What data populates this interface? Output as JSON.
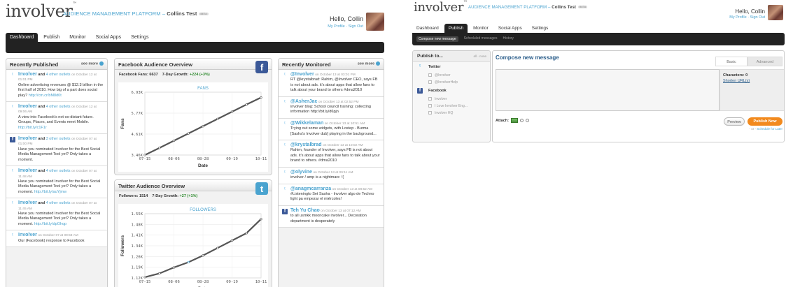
{
  "left": {
    "brand": {
      "logo": "involver",
      "tm": "™",
      "platform": "AUDIENCE MANAGEMENT PLATFORM",
      "dash": "–",
      "account": "Collins Test",
      "badge": "BETA"
    },
    "user": {
      "greeting": "Hello, Collin",
      "profile_link": "My Profile",
      "sep": "·",
      "signout_link": "Sign Out"
    },
    "nav": {
      "tabs": [
        "Dashboard",
        "Publish",
        "Monitor",
        "Social Apps",
        "Settings"
      ],
      "active": 0
    },
    "recently_published": {
      "title": "Recently Published",
      "see_more": "see more",
      "items": [
        {
          "author": "Involver",
          "and_text": "and",
          "others": "4 other outlets",
          "meta": "on October 12 at 01:01 PM",
          "body": "Online advertising revenues @ $12.3 billion in the first half of 2010. How big of a part does social play?",
          "link": "http://cm.cr/bM8d0t",
          "source": "twitter"
        },
        {
          "author": "Involver",
          "and_text": "and",
          "others": "4 other outlets",
          "meta": "on October 12 at 09:06 AM",
          "body": "A view into Facebook's not-so-distant future. Groups, Places, and Events meet Mobile.",
          "link": "http://bit.ly/c1F1r",
          "source": "twitter"
        },
        {
          "author": "Involver",
          "and_text": "and",
          "others": "3 other outlets",
          "meta": "on October 07 at 01:00 PM",
          "body": "Have you nominated Involver for the Best Social Media Management Tool yet? Only takes a moment.",
          "link": "",
          "source": "facebook"
        },
        {
          "author": "Involver",
          "and_text": "and",
          "others": "4 other outlets",
          "meta": "on October 07 at 11:48 AM",
          "body": "Have you nominated Involver for the Best Social Media Management Tool yet? Only takes a moment.",
          "link": "http://bit.ly/auYjmw",
          "source": "twitter"
        },
        {
          "author": "Involver",
          "and_text": "and",
          "others": "4 other outlets",
          "meta": "on October 07 at 11:45 AM",
          "body": "Have you nominated Involver for the Best Social Media Management Tool yet? Only takes a moment.",
          "link": "http://bit.ly/dpGhqp",
          "source": "twitter"
        },
        {
          "author": "Involver",
          "and_text": "",
          "others": "",
          "meta": "on October 07 at 09:58 AM",
          "body": "Our (Facebook) response to Facebook",
          "link": "",
          "source": "twitter"
        }
      ]
    },
    "facebook_overview": {
      "title": "Facebook Audience Overview",
      "stat_label": "Facebook Fans:",
      "stat_value": "6637",
      "growth_label": "7-Day Growth:",
      "growth_value": "+224 (+3%)",
      "icon": "facebook-icon",
      "icon_glyph": "f",
      "icon_color": "#3b5998",
      "chart_data": {
        "type": "line",
        "title": "FANS",
        "xlabel": "Date",
        "ylabel": "Fans",
        "x_ticks": [
          "07-15",
          "08-06",
          "08-28",
          "09-19",
          "10-11"
        ],
        "y_ticks": [
          "3.46K",
          "4.61K",
          "5.77K",
          "6.93K"
        ],
        "ylim": [
          3460,
          6930
        ],
        "x": [
          "07-15",
          "07-26",
          "08-06",
          "08-17",
          "08-28",
          "09-08",
          "09-19",
          "09-30",
          "10-11"
        ],
        "values": [
          3460,
          3850,
          4250,
          4650,
          5050,
          5450,
          5850,
          6250,
          6637
        ],
        "grid": true,
        "color": "#555555"
      }
    },
    "twitter_overview": {
      "title": "Twitter Audience Overview",
      "stat_label": "Followers:",
      "stat_value": "1514",
      "growth_label": "7-Day Growth:",
      "growth_value": "+27 (+1%)",
      "icon": "twitter-icon",
      "icon_glyph": "t",
      "icon_color": "#4aa3cf",
      "chart_data": {
        "type": "line",
        "title": "FOLLOWERS",
        "xlabel": "Date",
        "ylabel": "Followers",
        "x_ticks": [
          "07-15",
          "08-06",
          "08-28",
          "09-19",
          "10-11"
        ],
        "y_ticks": [
          "1.12K",
          "1.19K",
          "1.26K",
          "1.34K",
          "1.41K",
          "1.48K",
          "1.55K"
        ],
        "ylim": [
          1120,
          1550
        ],
        "x": [
          "07-15",
          "07-26",
          "08-06",
          "08-17",
          "08-28",
          "09-08",
          "09-19",
          "09-30",
          "10-11"
        ],
        "values": [
          1125,
          1150,
          1190,
          1225,
          1270,
          1320,
          1370,
          1420,
          1514
        ],
        "grid": true,
        "color": "#555555",
        "marker_color": "#4aa3cf"
      }
    },
    "recently_monitored": {
      "title": "Recently Monitored",
      "see_more": "see more",
      "items": [
        {
          "author": "@Involver",
          "meta": "on October 13 at 03:01 PM",
          "body": "RT @krystalbrad: Rahim, @Involver CEO, says FB is not about ads. it's about apps that allow fans to talk about your brand to others #dma2010",
          "source": "twitter"
        },
        {
          "author": "@AsherJac",
          "meta": "on October 13 at 02:52 PM",
          "body": "involver blog: School council training: collecting information http://bit.ly/d6pjn",
          "source": "twitter"
        },
        {
          "author": "@Wikkelaman",
          "meta": "on October 13 at 10:51 AM",
          "body": "Trying out some widgets, with Lostep - Burma [Sasha's Involver dub] playing in the background...",
          "source": "twitter"
        },
        {
          "author": "@krystalbrad",
          "meta": "on October 13 at 10:02 AM",
          "body": "Rahim, founder of Involver, says FB is not about ads. it's about apps that allow fans to talk about your brand to others. #dma2010",
          "source": "twitter"
        },
        {
          "author": "@olyvine",
          "meta": "on October 13 at 09:11 AM",
          "body": "involver / amp is a nightmare :'(",
          "source": "twitter"
        },
        {
          "author": "@anagmcarranza",
          "meta": "on October 13 at 08:52 AM",
          "body": "#Listeningto Set Sasha - Involver algo de Techno light pa empezar el miércoles!",
          "source": "twitter"
        },
        {
          "author": "Teh Yu Chao",
          "meta": "on October 13 at 07:12 AM",
          "body": "to all usmkk mooncake involver... Decoration department is desperately",
          "source": "facebook"
        }
      ]
    }
  },
  "right": {
    "brand": {
      "logo": "involver",
      "tm": "™",
      "platform": "AUDIENCE MANAGEMENT PLATFORM",
      "dash": "–",
      "account": "Collins Test",
      "badge": "BETA"
    },
    "user": {
      "greeting": "Hello, Collin",
      "profile_link": "My Profile",
      "sep": "·",
      "signout_link": "Sign Out"
    },
    "nav": {
      "tabs": [
        "Dashboard",
        "Publish",
        "Monitor",
        "Social Apps",
        "Settings"
      ],
      "active": 1
    },
    "subtabs": [
      "Compose new message",
      "Scheduled messages",
      "History"
    ],
    "publish_to": {
      "title": "Publish to...",
      "all_none": "all · none",
      "groups": [
        {
          "name": "Twitter",
          "source": "twitter",
          "accounts": [
            "@Involver",
            "@InvolverHelp"
          ]
        },
        {
          "name": "Facebook",
          "source": "facebook",
          "accounts": [
            "Involver",
            "I Love Involver Eng...",
            "Involver HQ"
          ]
        }
      ]
    },
    "compose": {
      "title": "Compose new message",
      "tabs": [
        "Basic",
        "Advanced"
      ],
      "characters_label": "Characters:",
      "characters_value": "0",
      "shorten": "Shorten URL(s)",
      "attach_label": "Attach:",
      "preview": "Preview",
      "publish_now": "Publish Now",
      "or_text": "- or -",
      "schedule": "Schedule for Later"
    }
  }
}
